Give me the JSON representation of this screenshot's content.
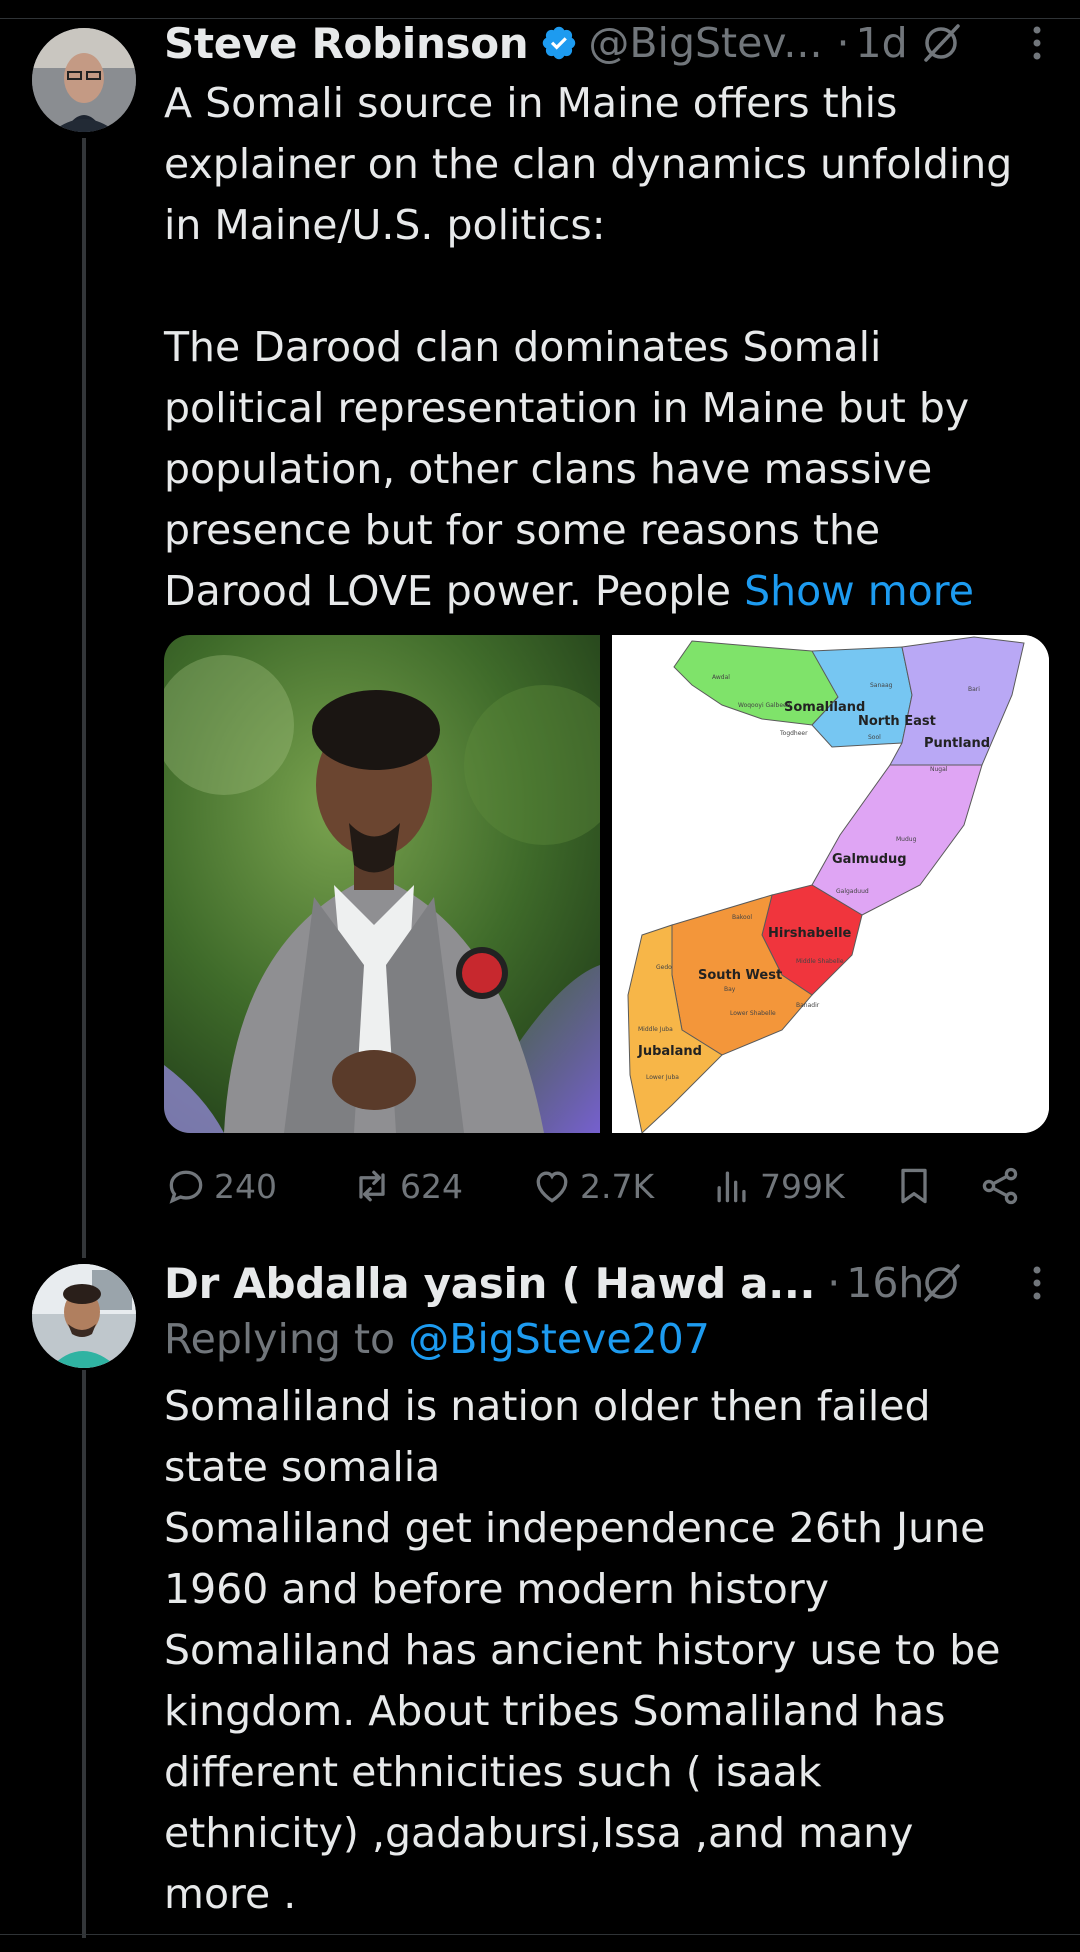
{
  "tweet1": {
    "name": "Steve Robinson",
    "handle": "@BigStev...",
    "time": "1d",
    "dot": "·",
    "text": "A Somali source in Maine offers this\nexplainer on the clan dynamics unfolding\nin Maine/U.S. politics:\n\nThe Darood clan dominates Somali\npolitical representation in Maine but by\npopulation, other clans have massive\npresence but for some reasons the\nDarood LOVE power. People ",
    "show_more": "Show more",
    "map_labels": {
      "somaliland": "Somaliland",
      "north_east": "North East",
      "puntland": "Puntland",
      "galmudug": "Galmudug",
      "hirshabelle": "Hirshabelle",
      "south_west": "South West",
      "jubaland": "Jubaland",
      "awdal": "Awdal",
      "woqooyi_galbeed": "Woqooyi Galbeed",
      "togdheer": "Togdheer",
      "sanaag": "Sanaag",
      "sool": "Sool",
      "bari": "Bari",
      "nugal": "Nugal",
      "mudug": "Mudug",
      "galgaduud": "Galgaduud",
      "bakool": "Bakool",
      "middle_shabelle": "Middle Shabelle",
      "gedo": "Gedo",
      "bay": "Bay",
      "lower_shabelle": "Lower Shabelle",
      "banadir": "Banadir",
      "middle_juba": "Middle Juba",
      "lower_juba": "Lower Juba"
    },
    "stats": {
      "replies": "240",
      "reposts": "624",
      "likes": "2.7K",
      "views": "799K"
    }
  },
  "tweet2": {
    "name": "Dr Abdalla yasin ( Hawd a...",
    "dot": "·",
    "time": "16h",
    "replying_prefix": "Replying to ",
    "replying_to": "@BigSteve207",
    "text": "Somaliland is nation older then failed\nstate somalia\nSomaliland get independence 26th June\n1960 and before modern history\nSomaliland has ancient history use to be\nkingdom. About tribes Somaliland has\ndifferent ethnicities such ( isaak\nethnicity) ,gadabursi,Issa ,and many\nmore ."
  },
  "colors": {
    "background": "#000000",
    "text": "#e7e9ea",
    "muted": "#71767b",
    "link": "#1d9bf0",
    "divider": "#2f3336"
  },
  "icons": {
    "verified": "verified-badge-icon",
    "grok": "grok-icon",
    "more": "more-icon",
    "reply": "reply-icon",
    "repost": "repost-icon",
    "like": "like-icon",
    "views": "views-icon",
    "bookmark": "bookmark-icon",
    "share": "share-icon"
  }
}
